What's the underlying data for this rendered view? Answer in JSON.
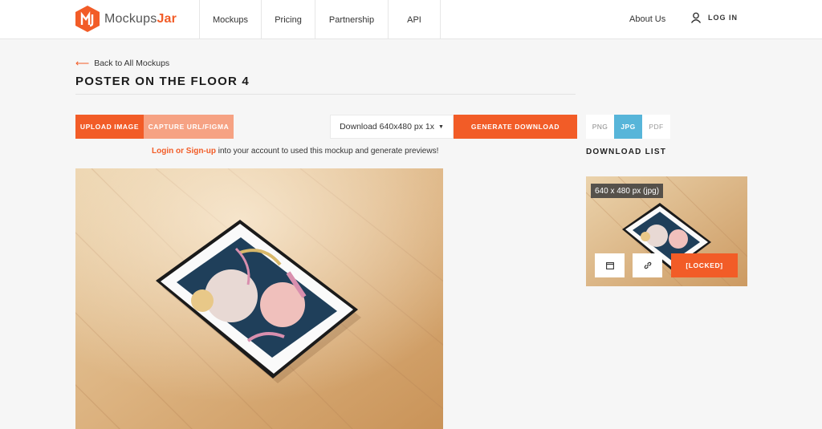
{
  "header": {
    "brand_light": "Mockups",
    "brand_bold": "Jar",
    "nav": [
      "Mockups",
      "Pricing",
      "Partnership",
      "API"
    ],
    "about": "About Us",
    "login": "LOG IN"
  },
  "page": {
    "back_link": "Back to All Mockups",
    "title": "POSTER ON THE FLOOR 4"
  },
  "toolbar": {
    "upload": "UPLOAD IMAGE",
    "capture": "CAPTURE URL/FIGMA",
    "download_select": "Download 640x480 px 1x",
    "generate": "GENERATE DOWNLOAD",
    "formats": [
      "PNG",
      "JPG",
      "PDF"
    ],
    "selected_format": "JPG"
  },
  "notice": {
    "link": "Login or Sign-up",
    "text": " into your account to used this mockup and generate previews!"
  },
  "download_list": {
    "title": "DOWNLOAD LIST",
    "item_label": "640 x 480 px (jpg)",
    "locked": "[LOCKED]"
  },
  "colors": {
    "accent": "#f25c27",
    "accent_light": "#f6a283",
    "selected_format": "#57b5d9",
    "background": "#f6f6f6"
  },
  "icons": [
    "logo-icon",
    "user-icon",
    "arrow-left-icon",
    "caret-down-icon",
    "frame-icon",
    "link-icon"
  ]
}
